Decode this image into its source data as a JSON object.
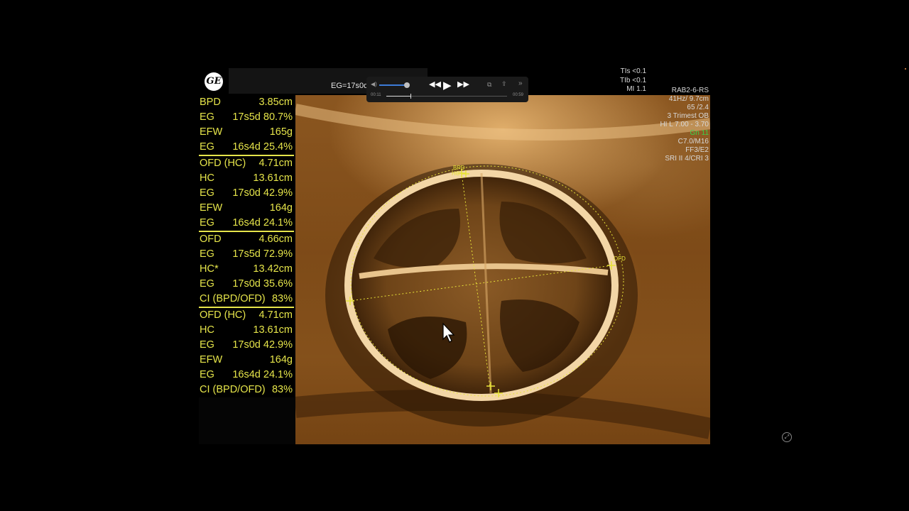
{
  "header": {
    "logo_text": "GE",
    "eg_label": "EG=17s0d"
  },
  "measurements": {
    "groups": [
      [
        {
          "label": "BPD",
          "value": "3.85cm"
        },
        {
          "label": "EG",
          "value": "17s5d 80.7%"
        },
        {
          "label": "EFW",
          "value": "165g"
        },
        {
          "label": "EG",
          "value": "16s4d 25.4%"
        }
      ],
      [
        {
          "label": "OFD (HC)",
          "value": "4.71cm"
        },
        {
          "label": "HC",
          "value": "13.61cm"
        },
        {
          "label": "EG",
          "value": "17s0d 42.9%"
        },
        {
          "label": "EFW",
          "value": "164g"
        },
        {
          "label": "EG",
          "value": "16s4d 24.1%"
        }
      ],
      [
        {
          "label": "OFD",
          "value": "4.66cm"
        },
        {
          "label": "EG",
          "value": "17s5d 72.9%"
        },
        {
          "label": "HC*",
          "value": "13.42cm"
        },
        {
          "label": "EG",
          "value": "17s0d 35.6%"
        },
        {
          "label": "CI (BPD/OFD)",
          "value": "83%"
        }
      ],
      [
        {
          "label": "OFD (HC)",
          "value": "4.71cm"
        },
        {
          "label": "HC",
          "value": "13.61cm"
        },
        {
          "label": "EG",
          "value": "17s0d 42.9%"
        },
        {
          "label": "EFW",
          "value": "164g"
        },
        {
          "label": "EG",
          "value": "16s4d 24.1%"
        },
        {
          "label": "CI (BPD/OFD)",
          "value": "83%"
        }
      ]
    ]
  },
  "media_player": {
    "current_time": "00:11",
    "end_time": "00:59",
    "progress": 0.2,
    "volume": 0.9,
    "icons": [
      "volume-icon",
      "rewind-icon",
      "play-icon",
      "fast-forward-icon",
      "pip-icon",
      "share-icon",
      "more-icon"
    ]
  },
  "safety": {
    "tis": "TIs <0.1",
    "tib": "TIb <0.1",
    "mi": "MI  1.1"
  },
  "probe": {
    "lines": [
      "RAB2-6-RS",
      "41Hz/ 9.7cm",
      "65 /2.4",
      "3 Trimest OB",
      "HI L  7.00 - 3.70",
      "Gn  11",
      "C7.0/M16",
      "FF3/E2",
      "SRI II 4/CRI 3"
    ],
    "gain_line_color": "#3bd14a"
  },
  "overlay_labels": {
    "bpd": "BPD",
    "hc": "HC",
    "ofd": "OFD"
  },
  "colors": {
    "measurement_text": "#e6e54a",
    "sepia_bright": "#e8b070",
    "sepia_dark": "#5a3310"
  }
}
